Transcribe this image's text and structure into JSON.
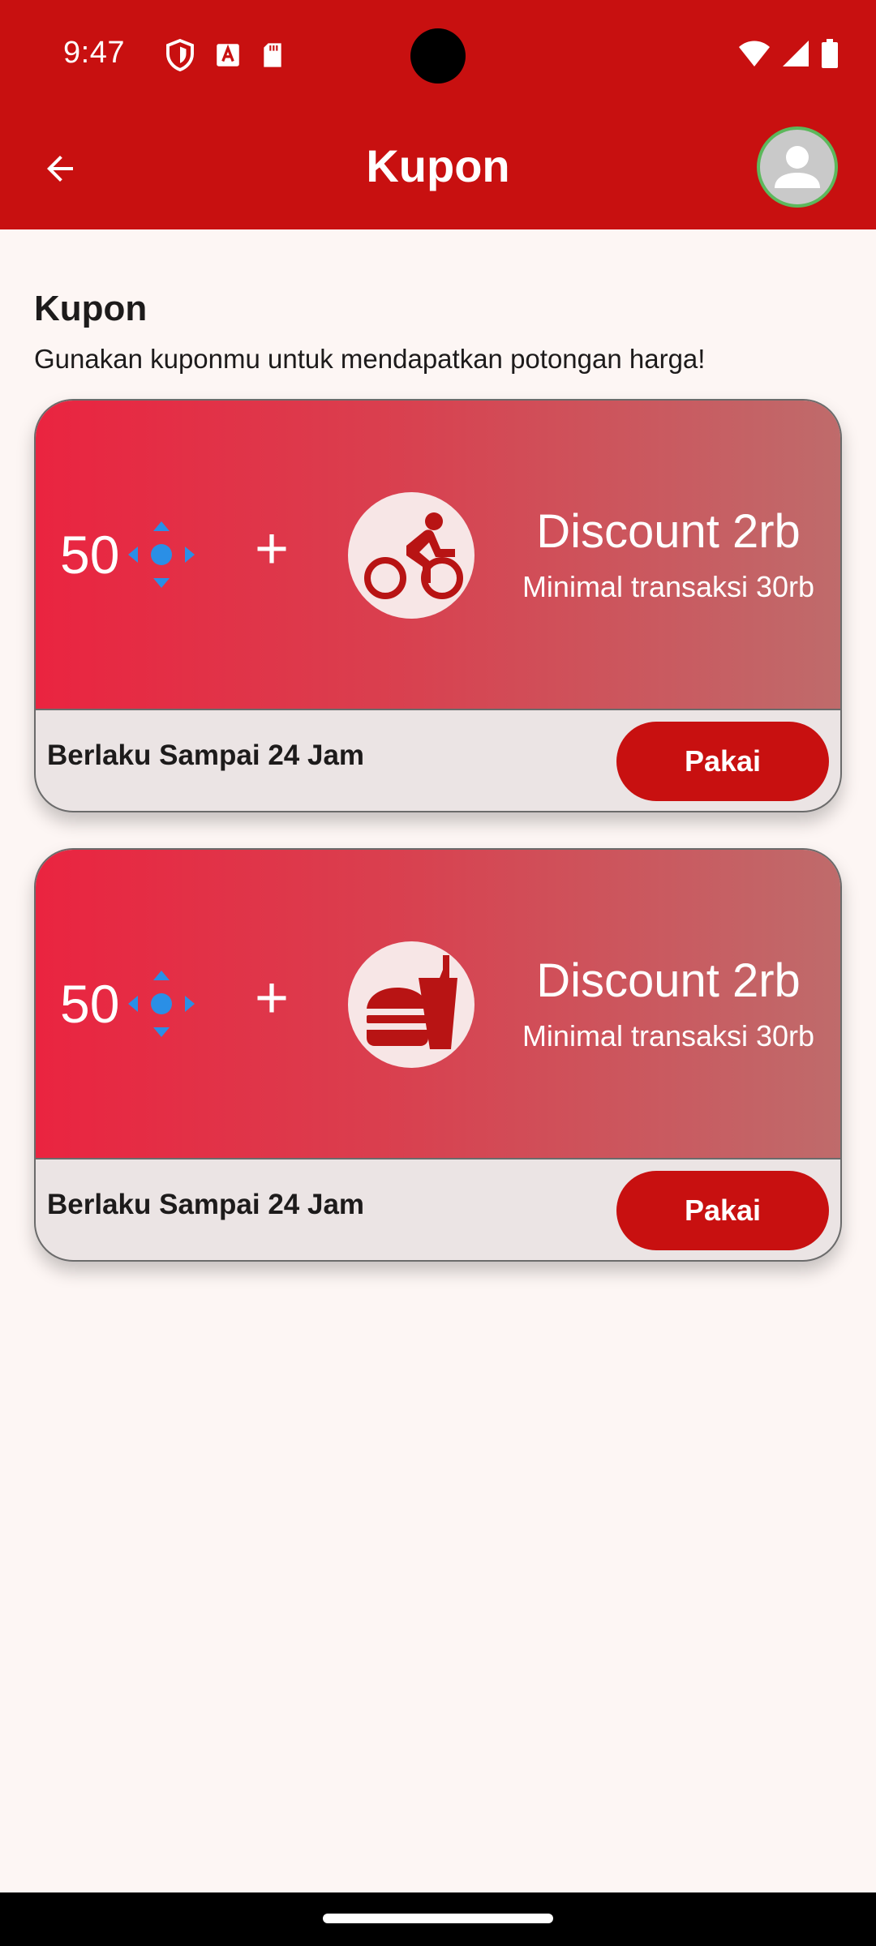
{
  "status_bar": {
    "time": "9:47",
    "left_icons": [
      "shield-icon",
      "font-a-icon",
      "sd-card-icon"
    ],
    "right_icons": [
      "wifi-icon",
      "signal-icon",
      "battery-icon"
    ]
  },
  "app_bar": {
    "title": "Kupon",
    "back_icon": "arrow-left-icon",
    "avatar_icon": "person-icon"
  },
  "section": {
    "title": "Kupon",
    "subtitle": "Gunakan kuponmu untuk mendapatkan potongan harga!"
  },
  "coupons": [
    {
      "points": "50",
      "points_icon": "diamond-points-icon",
      "plus": "+",
      "service_icon": "bike-icon",
      "title": "Discount 2rb",
      "min_transaction": "Minimal transaksi 30rb",
      "validity": "Berlaku Sampai 24 Jam",
      "button_label": "Pakai"
    },
    {
      "points": "50",
      "points_icon": "diamond-points-icon",
      "plus": "+",
      "service_icon": "food-icon",
      "title": "Discount 2rb",
      "min_transaction": "Minimal transaksi 30rb",
      "validity": "Berlaku Sampai 24 Jam",
      "button_label": "Pakai"
    }
  ],
  "colors": {
    "primary": "#c81010",
    "background": "#fdf6f4",
    "gradient_start": "#ea2440",
    "gradient_end": "#bf6b6b",
    "points_icon": "#2a8fe6",
    "avatar_border": "#5cb85c"
  }
}
